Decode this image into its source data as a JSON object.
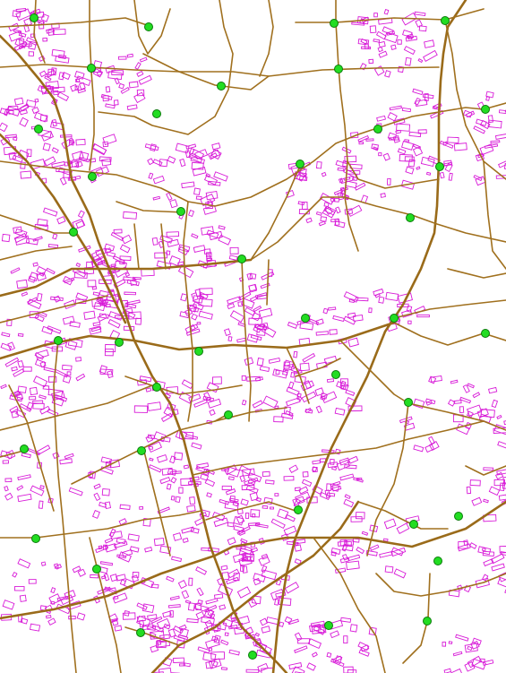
{
  "map": {
    "background": "#ffffff",
    "road_color": "#a0701e",
    "building_color": "#d81bd8",
    "poi_color": "#22dd22",
    "poi_outline": "#0a7a0a",
    "labels": [],
    "layers": [
      "roads",
      "buildings",
      "points-of-interest"
    ]
  }
}
